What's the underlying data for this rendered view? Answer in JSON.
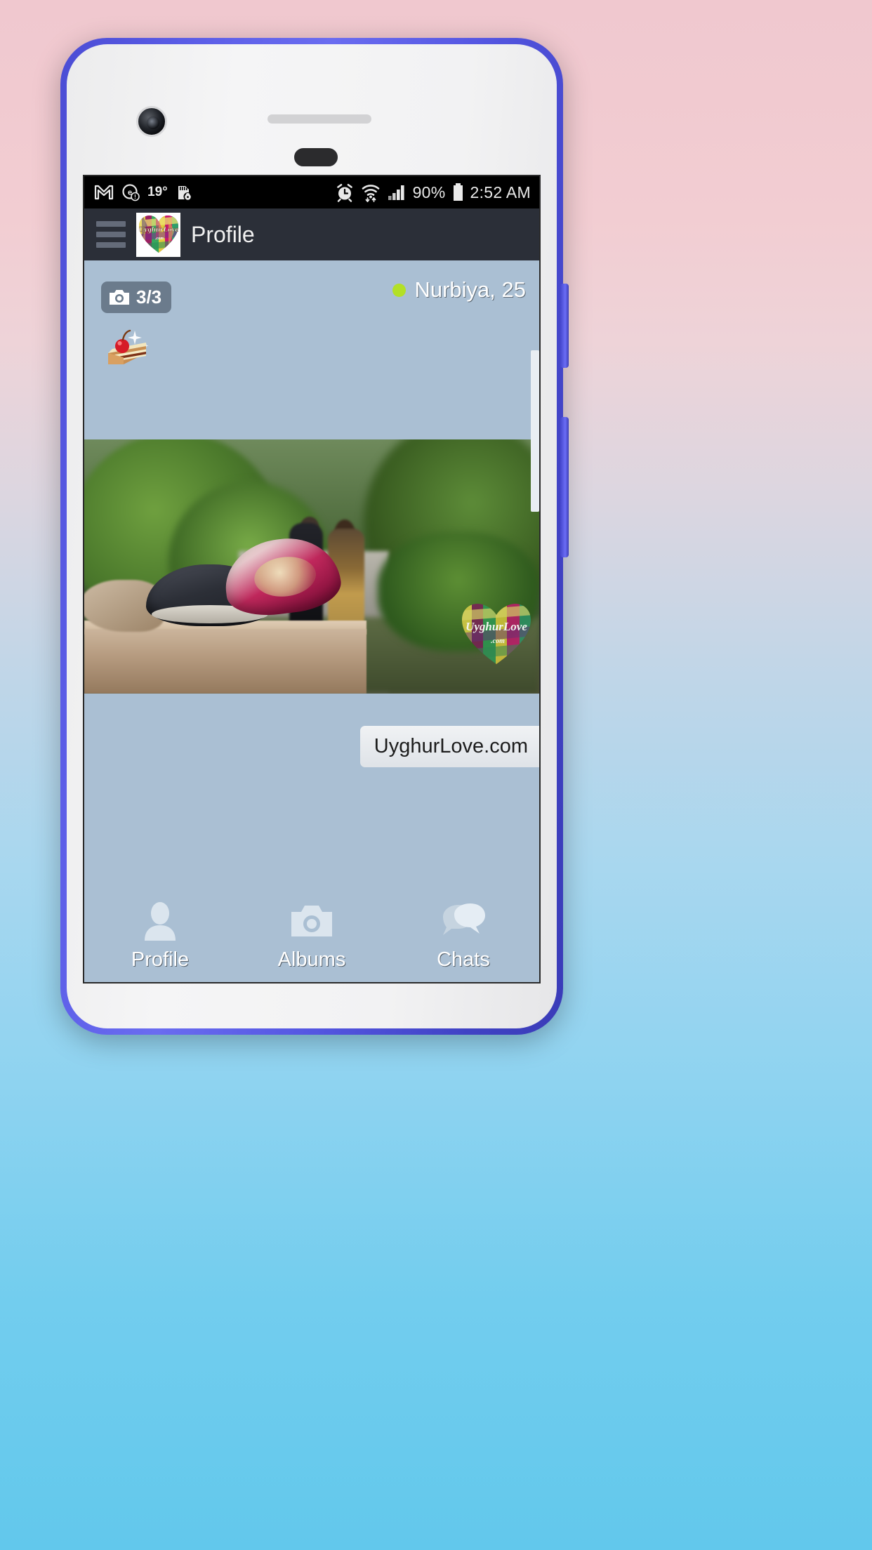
{
  "status_bar": {
    "icons_left": [
      "gmail-icon",
      "do-not-disturb-icon",
      "sd-card-lock-icon"
    ],
    "temperature": "19°",
    "icons_right": [
      "alarm-icon",
      "wifi-icon",
      "signal-icon",
      "battery-icon"
    ],
    "battery_percent": "90%",
    "time": "2:52 AM"
  },
  "app_bar": {
    "menu_icon": "hamburger-menu-icon",
    "logo_alt": "UyghurLove",
    "title": "Profile"
  },
  "profile": {
    "photo_count": "3/3",
    "camera_icon": "camera-icon",
    "online_dot_color": "#b3e026",
    "name_age": "Nurbiya, 25",
    "status_emoji": "cake-emoji",
    "photo_watermark": "UyghurLove.com"
  },
  "website_chip": {
    "label": "UyghurLove.com"
  },
  "bottom_nav": {
    "items": [
      {
        "label": "Profile",
        "icon": "person-icon"
      },
      {
        "label": "Albums",
        "icon": "camera-icon"
      },
      {
        "label": "Chats",
        "icon": "chat-bubbles-icon"
      }
    ]
  },
  "colors": {
    "app_bar_bg": "#2b2f38",
    "content_bg": "#aabfd3",
    "status_bar_bg": "#000000",
    "phone_frame": "#5557e2",
    "badge_bg": "#6b7b8c"
  }
}
